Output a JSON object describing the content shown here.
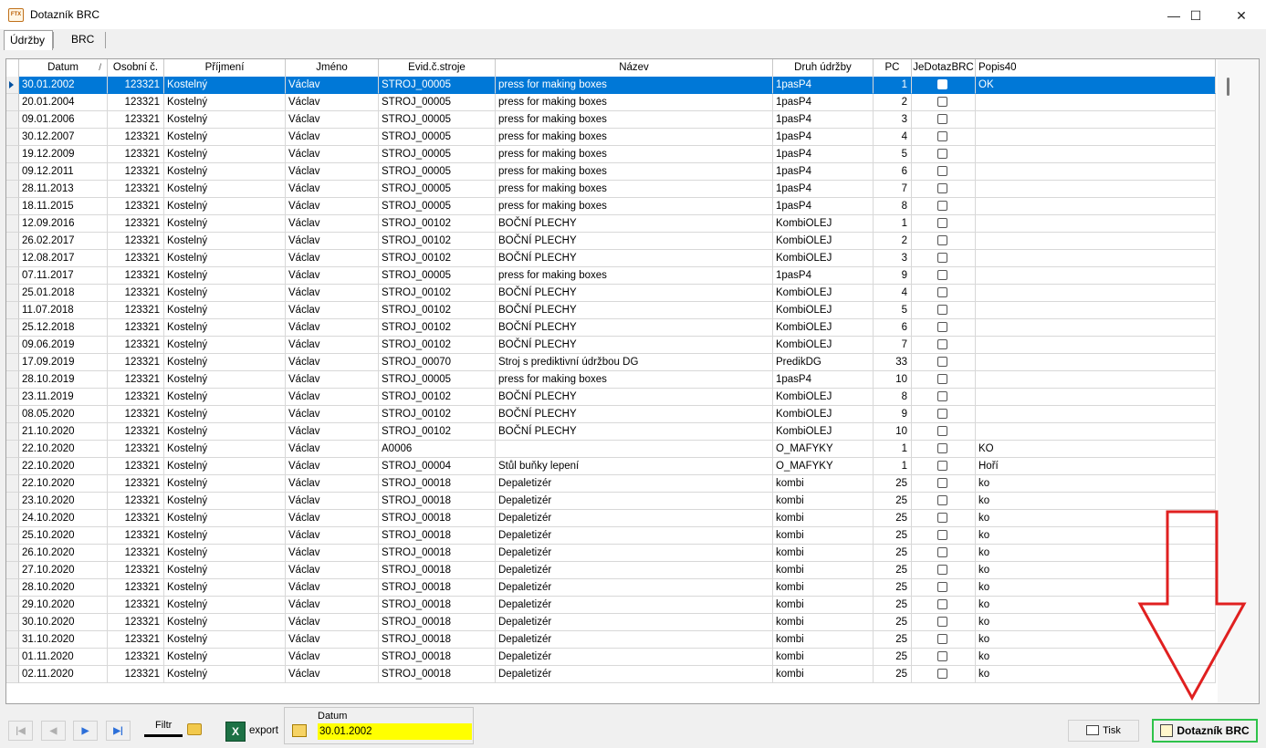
{
  "window": {
    "app_icon": "FTX",
    "title": "Dotazník BRC",
    "minimize": "—",
    "maximize": "☐",
    "close": "✕"
  },
  "tabs": [
    {
      "label": "Údržby",
      "active": true
    },
    {
      "label": "BRC",
      "active": false
    }
  ],
  "grid": {
    "columns": [
      "Datum",
      "Osobní č.",
      "Příjmení",
      "Jméno",
      "Evid.č.stroje",
      "Název",
      "Druh údržby",
      "PC",
      "JeDotazBRC",
      "Popis40"
    ],
    "sort_column": "Datum",
    "sort_mark": "/",
    "selected_row": 0,
    "rows": [
      [
        "30.01.2002",
        "123321",
        "Kostelný",
        "Václav",
        "STROJ_00005",
        "press for making boxes",
        "1pasP4",
        "1",
        "",
        "OK"
      ],
      [
        "20.01.2004",
        "123321",
        "Kostelný",
        "Václav",
        "STROJ_00005",
        "press for making boxes",
        "1pasP4",
        "2",
        "",
        ""
      ],
      [
        "09.01.2006",
        "123321",
        "Kostelný",
        "Václav",
        "STROJ_00005",
        "press for making boxes",
        "1pasP4",
        "3",
        "",
        ""
      ],
      [
        "30.12.2007",
        "123321",
        "Kostelný",
        "Václav",
        "STROJ_00005",
        "press for making boxes",
        "1pasP4",
        "4",
        "",
        ""
      ],
      [
        "19.12.2009",
        "123321",
        "Kostelný",
        "Václav",
        "STROJ_00005",
        "press for making boxes",
        "1pasP4",
        "5",
        "",
        ""
      ],
      [
        "09.12.2011",
        "123321",
        "Kostelný",
        "Václav",
        "STROJ_00005",
        "press for making boxes",
        "1pasP4",
        "6",
        "",
        ""
      ],
      [
        "28.11.2013",
        "123321",
        "Kostelný",
        "Václav",
        "STROJ_00005",
        "press for making boxes",
        "1pasP4",
        "7",
        "",
        ""
      ],
      [
        "18.11.2015",
        "123321",
        "Kostelný",
        "Václav",
        "STROJ_00005",
        "press for making boxes",
        "1pasP4",
        "8",
        "",
        ""
      ],
      [
        "12.09.2016",
        "123321",
        "Kostelný",
        "Václav",
        "STROJ_00102",
        "BOČNÍ PLECHY",
        "KombiOLEJ",
        "1",
        "",
        ""
      ],
      [
        "26.02.2017",
        "123321",
        "Kostelný",
        "Václav",
        "STROJ_00102",
        "BOČNÍ PLECHY",
        "KombiOLEJ",
        "2",
        "",
        ""
      ],
      [
        "12.08.2017",
        "123321",
        "Kostelný",
        "Václav",
        "STROJ_00102",
        "BOČNÍ PLECHY",
        "KombiOLEJ",
        "3",
        "",
        ""
      ],
      [
        "07.11.2017",
        "123321",
        "Kostelný",
        "Václav",
        "STROJ_00005",
        "press for making boxes",
        "1pasP4",
        "9",
        "",
        ""
      ],
      [
        "25.01.2018",
        "123321",
        "Kostelný",
        "Václav",
        "STROJ_00102",
        "BOČNÍ PLECHY",
        "KombiOLEJ",
        "4",
        "",
        ""
      ],
      [
        "11.07.2018",
        "123321",
        "Kostelný",
        "Václav",
        "STROJ_00102",
        "BOČNÍ PLECHY",
        "KombiOLEJ",
        "5",
        "",
        ""
      ],
      [
        "25.12.2018",
        "123321",
        "Kostelný",
        "Václav",
        "STROJ_00102",
        "BOČNÍ PLECHY",
        "KombiOLEJ",
        "6",
        "",
        ""
      ],
      [
        "09.06.2019",
        "123321",
        "Kostelný",
        "Václav",
        "STROJ_00102",
        "BOČNÍ PLECHY",
        "KombiOLEJ",
        "7",
        "",
        ""
      ],
      [
        "17.09.2019",
        "123321",
        "Kostelný",
        "Václav",
        "STROJ_00070",
        "Stroj s prediktivní údržbou DG",
        "PredikDG",
        "33",
        "",
        ""
      ],
      [
        "28.10.2019",
        "123321",
        "Kostelný",
        "Václav",
        "STROJ_00005",
        "press for making boxes",
        "1pasP4",
        "10",
        "",
        ""
      ],
      [
        "23.11.2019",
        "123321",
        "Kostelný",
        "Václav",
        "STROJ_00102",
        "BOČNÍ PLECHY",
        "KombiOLEJ",
        "8",
        "",
        ""
      ],
      [
        "08.05.2020",
        "123321",
        "Kostelný",
        "Václav",
        "STROJ_00102",
        "BOČNÍ PLECHY",
        "KombiOLEJ",
        "9",
        "",
        ""
      ],
      [
        "21.10.2020",
        "123321",
        "Kostelný",
        "Václav",
        "STROJ_00102",
        "BOČNÍ PLECHY",
        "KombiOLEJ",
        "10",
        "",
        ""
      ],
      [
        "22.10.2020",
        "123321",
        "Kostelný",
        "Václav",
        "A0006",
        "",
        "O_MAFYKY",
        "1",
        "",
        "KO"
      ],
      [
        "22.10.2020",
        "123321",
        "Kostelný",
        "Václav",
        "STROJ_00004",
        "Stůl buňky lepení",
        "O_MAFYKY",
        "1",
        "",
        "Hoří"
      ],
      [
        "22.10.2020",
        "123321",
        "Kostelný",
        "Václav",
        "STROJ_00018",
        "Depaletizér",
        "kombi",
        "25",
        "",
        "ko"
      ],
      [
        "23.10.2020",
        "123321",
        "Kostelný",
        "Václav",
        "STROJ_00018",
        "Depaletizér",
        "kombi",
        "25",
        "",
        "ko"
      ],
      [
        "24.10.2020",
        "123321",
        "Kostelný",
        "Václav",
        "STROJ_00018",
        "Depaletizér",
        "kombi",
        "25",
        "",
        "ko"
      ],
      [
        "25.10.2020",
        "123321",
        "Kostelný",
        "Václav",
        "STROJ_00018",
        "Depaletizér",
        "kombi",
        "25",
        "",
        "ko"
      ],
      [
        "26.10.2020",
        "123321",
        "Kostelný",
        "Václav",
        "STROJ_00018",
        "Depaletizér",
        "kombi",
        "25",
        "",
        "ko"
      ],
      [
        "27.10.2020",
        "123321",
        "Kostelný",
        "Václav",
        "STROJ_00018",
        "Depaletizér",
        "kombi",
        "25",
        "",
        "ko"
      ],
      [
        "28.10.2020",
        "123321",
        "Kostelný",
        "Václav",
        "STROJ_00018",
        "Depaletizér",
        "kombi",
        "25",
        "",
        "ko"
      ],
      [
        "29.10.2020",
        "123321",
        "Kostelný",
        "Václav",
        "STROJ_00018",
        "Depaletizér",
        "kombi",
        "25",
        "",
        "ko"
      ],
      [
        "30.10.2020",
        "123321",
        "Kostelný",
        "Václav",
        "STROJ_00018",
        "Depaletizér",
        "kombi",
        "25",
        "",
        "ko"
      ],
      [
        "31.10.2020",
        "123321",
        "Kostelný",
        "Václav",
        "STROJ_00018",
        "Depaletizér",
        "kombi",
        "25",
        "",
        "ko"
      ],
      [
        "01.11.2020",
        "123321",
        "Kostelný",
        "Václav",
        "STROJ_00018",
        "Depaletizér",
        "kombi",
        "25",
        "",
        "ko"
      ],
      [
        "02.11.2020",
        "123321",
        "Kostelný",
        "Václav",
        "STROJ_00018",
        "Depaletizér",
        "kombi",
        "25",
        "",
        "ko"
      ]
    ]
  },
  "footer": {
    "nav_first": "|◀",
    "nav_prev": "◀",
    "nav_next": "▶",
    "nav_last": "▶|",
    "filter_label": "Filtr",
    "excel_icon_text": "X",
    "export_label": "export",
    "date_caption": "Datum",
    "date_value": "30.01.2002",
    "print_label": "Tisk",
    "brc_button_label": "Dotazník BRC"
  },
  "colors": {
    "selection": "#0078d7",
    "date_highlight": "#ffff00",
    "brc_border": "#2ec24a",
    "annotation_arrow": "#e02020"
  }
}
